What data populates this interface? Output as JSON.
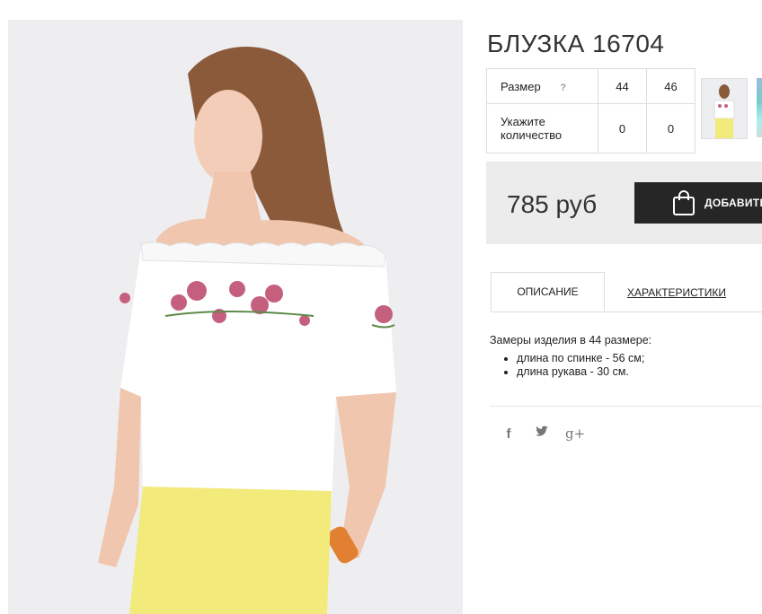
{
  "product": {
    "title": "БЛУЗКА 16704"
  },
  "sizes": {
    "size_label": "Размер",
    "help_icon": "?",
    "qty_label": "Укажите количество",
    "options": [
      {
        "size": "44",
        "qty": "0"
      },
      {
        "size": "46",
        "qty": "0"
      }
    ]
  },
  "buy": {
    "price": "785 руб",
    "add_label": "ДОБАВИТЬ",
    "icon": "shopping-bag-icon"
  },
  "tabs": [
    {
      "label": "ОПИСАНИЕ"
    },
    {
      "label": "ХАРАКТЕРИСТИКИ"
    }
  ],
  "description": {
    "intro": "Замеры изделия в 44 размере:",
    "items": [
      "длина по спинке - 56 см;",
      "длина рукава - 30 см."
    ]
  },
  "social": {
    "facebook": "f",
    "twitter": "twitter-icon",
    "gplus": "g+"
  }
}
